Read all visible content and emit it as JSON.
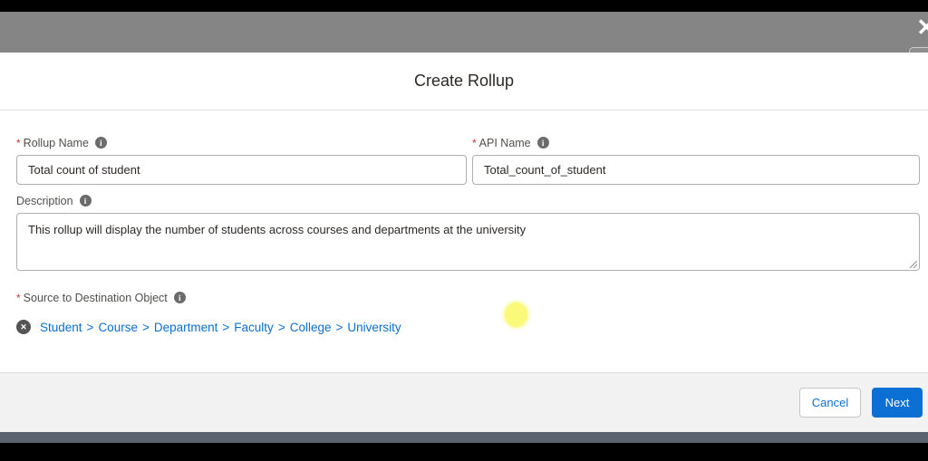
{
  "chrome": {
    "close_icon_glyph": "✕"
  },
  "modal": {
    "title": "Create Rollup",
    "required_marker": "*",
    "info_icon_glyph": "i",
    "fields": {
      "rollup_name": {
        "label": "Rollup Name",
        "required": true,
        "value": "Total count of student"
      },
      "api_name": {
        "label": "API Name",
        "required": true,
        "value": "Total_count_of_student"
      },
      "description": {
        "label": "Description",
        "required": false,
        "value": "This rollup will display the number of students across courses and departments at the university"
      },
      "source_to_destination": {
        "label": "Source to Destination Object",
        "required": true
      }
    },
    "source_path": {
      "remove_icon_glyph": "✕",
      "separator": ">",
      "items": [
        "Student",
        "Course",
        "Department",
        "Faculty",
        "College",
        "University"
      ]
    },
    "footer": {
      "cancel_label": "Cancel",
      "next_label": "Next"
    }
  },
  "cursor_highlight": {
    "color": "#faf97a"
  },
  "colors": {
    "brand_blue": "#0b6fd3",
    "link_blue": "#0b6fd3",
    "required_red": "#c23934",
    "top_bar_gray": "#858585",
    "footer_gray": "#f3f2f2",
    "bottom_slate": "#5b6370"
  }
}
